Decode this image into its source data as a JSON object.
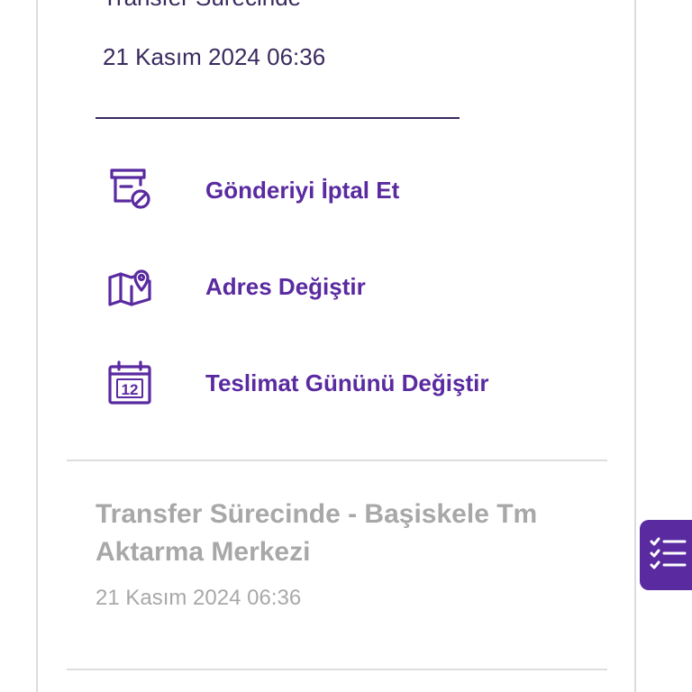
{
  "status": {
    "title": "Transfer Sürecinde",
    "date": "21 Kasım 2024 06:36"
  },
  "actions": [
    {
      "label": "Gönderiyi İptal Et",
      "icon": "cancel-shipment-icon"
    },
    {
      "label": "Adres Değiştir",
      "icon": "map-pin-icon"
    },
    {
      "label": "Teslimat Gününü Değiştir",
      "icon": "calendar-icon",
      "icon_text": "12"
    }
  ],
  "event": {
    "title": "Transfer Sürecinde - Başiskele Tm Aktarma Merkezi",
    "date": "21 Kasım 2024 06:36"
  },
  "fab": {
    "icon": "checklist-icon"
  },
  "colors": {
    "accent": "#5a2aa0",
    "text_dark": "#3a2a5e",
    "text_muted": "#a8a8a8",
    "divider": "#dedede"
  }
}
